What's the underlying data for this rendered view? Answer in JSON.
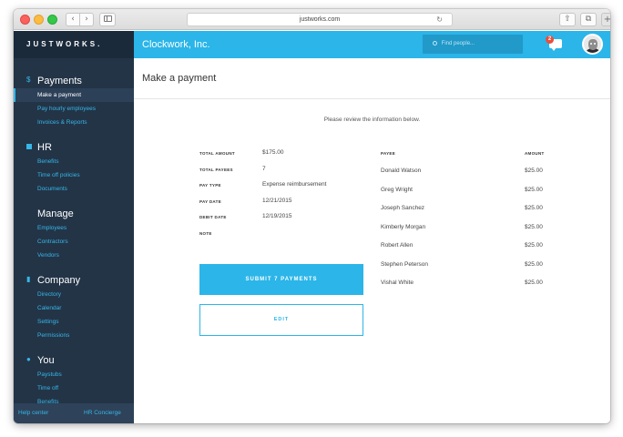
{
  "browser": {
    "url": "justworks.com",
    "back_glyph": "‹",
    "forward_glyph": "›",
    "reload_glyph": "↻",
    "share_glyph": "⇧",
    "tabs_glyph": "⧉",
    "newtab_glyph": "+"
  },
  "sidebar": {
    "brand": "JUSTWORKS.",
    "sections": [
      {
        "title": "Payments",
        "icon": "dollar-icon",
        "items": [
          "Make a payment",
          "Pay hourly employees",
          "Invoices & Reports"
        ]
      },
      {
        "title": "HR",
        "icon": "hr-square-icon",
        "items": [
          "Benefits",
          "Time off policies",
          "Documents"
        ]
      },
      {
        "title": "Manage",
        "icon": "",
        "items": [
          "Employees",
          "Contractors",
          "Vendors"
        ]
      },
      {
        "title": "Company",
        "icon": "bar-chart-icon",
        "items": [
          "Directory",
          "Calendar",
          "Settings",
          "Permissions"
        ]
      },
      {
        "title": "You",
        "icon": "person-icon",
        "items": [
          "Paystubs",
          "Time off",
          "Benefits"
        ]
      }
    ],
    "footer": {
      "help": "Help center",
      "concierge": "HR Concierge"
    }
  },
  "topbar": {
    "company": "Clockwork, Inc.",
    "search_placeholder": "Find people...",
    "notification_count": "2"
  },
  "page": {
    "title": "Make a payment",
    "instructions": "Please review the information below."
  },
  "summary": [
    {
      "label": "TOTAL AMOUNT",
      "value": "$175.00"
    },
    {
      "label": "TOTAL PAYEES",
      "value": "7"
    },
    {
      "label": "PAY TYPE",
      "value": "Expense reimbursement"
    },
    {
      "label": "PAY DATE",
      "value": "12/21/2015"
    },
    {
      "label": "DEBIT DATE",
      "value": "12/19/2015"
    },
    {
      "label": "NOTE",
      "value": ""
    }
  ],
  "payees": {
    "headers": {
      "payee": "PAYEE",
      "amount": "AMOUNT"
    },
    "rows": [
      {
        "name": "Donald Watson",
        "amount": "$25.00"
      },
      {
        "name": "Greg Wright",
        "amount": "$25.00"
      },
      {
        "name": "Joseph Sanchez",
        "amount": "$25.00"
      },
      {
        "name": "Kimberly Morgan",
        "amount": "$25.00"
      },
      {
        "name": "Robert Allen",
        "amount": "$25.00"
      },
      {
        "name": "Stephen Peterson",
        "amount": "$25.00"
      },
      {
        "name": "Vishal White",
        "amount": "$25.00"
      }
    ]
  },
  "actions": {
    "submit": "SUBMIT 7 PAYMENTS",
    "edit": "EDIT"
  },
  "colors": {
    "accent": "#2bb5e8",
    "sidebar_bg": "#233447",
    "link": "#36b7e8"
  }
}
